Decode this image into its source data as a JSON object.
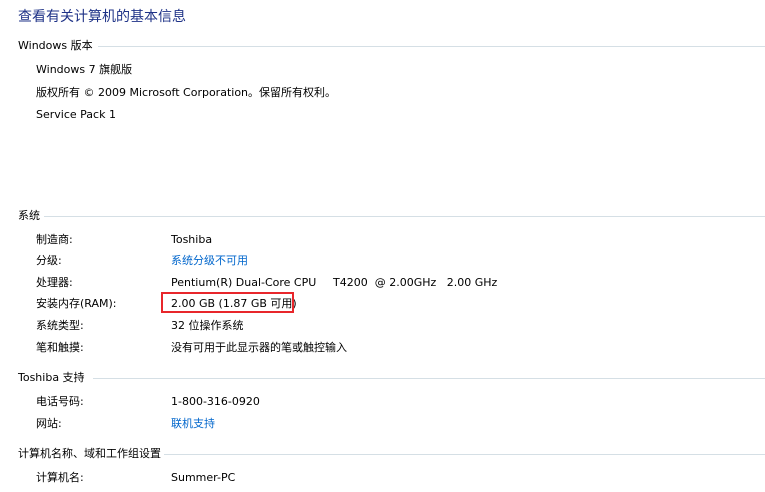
{
  "title": "查看有关计算机的基本信息",
  "windows_edition": {
    "heading": "Windows 版本",
    "edition": "Windows 7 旗舰版",
    "copyright": "版权所有 © 2009 Microsoft Corporation。保留所有权利。",
    "service_pack": "Service Pack 1"
  },
  "system": {
    "heading": "系统",
    "manufacturer_label": "制造商:",
    "manufacturer_value": "Toshiba",
    "rating_label": "分级:",
    "rating_value": "系统分级不可用",
    "processor_label": "处理器:",
    "processor_value": "Pentium(R) Dual-Core CPU",
    "processor_model": "T4200  @ 2.00GHz   2.00 GHz",
    "ram_label": "安装内存(RAM):",
    "ram_value": "2.00 GB (1.87 GB 可用)",
    "system_type_label": "系统类型:",
    "system_type_value": "32 位操作系统",
    "pen_touch_label": "笔和触摸:",
    "pen_touch_value": "没有可用于此显示器的笔或触控输入"
  },
  "support": {
    "heading": "Toshiba 支持",
    "phone_label": "电话号码:",
    "phone_value": "1-800-316-0920",
    "website_label": "网站:",
    "website_value": "联机支持"
  },
  "computer_name": {
    "heading": "计算机名称、域和工作组设置",
    "name_label": "计算机名:",
    "name_value": "Summer-PC"
  },
  "colors": {
    "title": "#1e3287",
    "link": "#0066cc",
    "highlight": "#e8262b",
    "separator": "#d5dfe5"
  }
}
